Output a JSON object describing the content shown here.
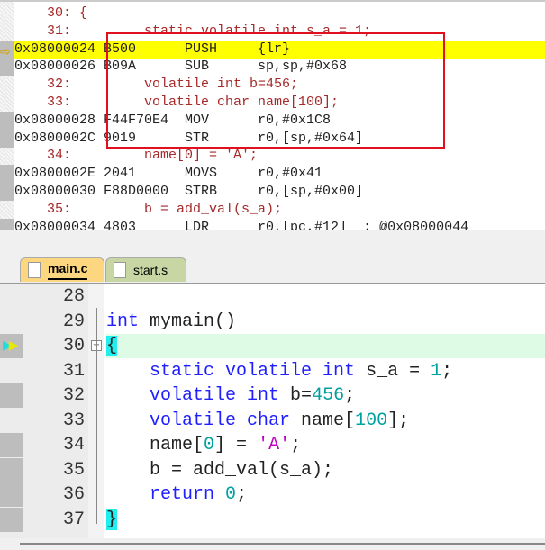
{
  "disassembly": {
    "rows": [
      {
        "kind": "src",
        "exec": false,
        "text": "    30: {"
      },
      {
        "kind": "src",
        "exec": false,
        "text": "    31:         static volatile int s_a = 1;"
      },
      {
        "kind": "asm",
        "exec": true,
        "current": true,
        "text": "0x08000024 B500      PUSH     {lr}"
      },
      {
        "kind": "asm",
        "exec": true,
        "text": "0x08000026 B09A      SUB      sp,sp,#0x68"
      },
      {
        "kind": "src",
        "exec": false,
        "text": "    32:         volatile int b=456;"
      },
      {
        "kind": "src",
        "exec": false,
        "text": "    33:         volatile char name[100];"
      },
      {
        "kind": "asm",
        "exec": true,
        "text": "0x08000028 F44F70E4  MOV      r0,#0x1C8"
      },
      {
        "kind": "asm",
        "exec": true,
        "text": "0x0800002C 9019      STR      r0,[sp,#0x64]"
      },
      {
        "kind": "src",
        "exec": false,
        "text": "    34:         name[0] = 'A';"
      },
      {
        "kind": "asm",
        "exec": true,
        "text": "0x0800002E 2041      MOVS     r0,#0x41"
      },
      {
        "kind": "asm",
        "exec": true,
        "text": "0x08000030 F88D0000  STRB     r0,[sp,#0x00]"
      },
      {
        "kind": "src",
        "exec": false,
        "text": "    35:         b = add_val(s_a);"
      },
      {
        "kind": "asm",
        "exec": true,
        "text": "0x08000034 4803      LDR      r0,[pc,#12]  ; @0x08000044"
      }
    ],
    "current_arrow_icon": "arrow-right-icon",
    "highlight_color": "#ffff00",
    "annotation_box_color": "#e0101e"
  },
  "tabs": [
    {
      "label": "main.c",
      "active": true,
      "icon": "file-icon"
    },
    {
      "label": "start.s",
      "active": false,
      "icon": "file-icon"
    }
  ],
  "editor": {
    "lines": [
      {
        "num": "28",
        "exec": false,
        "tokens": []
      },
      {
        "num": "29",
        "exec": false,
        "tokens": [
          {
            "t": "int",
            "c": "kw"
          },
          {
            "t": " mymain()",
            "c": ""
          }
        ]
      },
      {
        "num": "30",
        "exec": true,
        "current": true,
        "fold": true,
        "tokens": [
          {
            "t": "{",
            "c": "br"
          }
        ]
      },
      {
        "num": "31",
        "exec": false,
        "tokens": [
          {
            "t": "    ",
            "c": ""
          },
          {
            "t": "static volatile int",
            "c": "kw"
          },
          {
            "t": " s_a = ",
            "c": ""
          },
          {
            "t": "1",
            "c": "nm"
          },
          {
            "t": ";",
            "c": ""
          }
        ]
      },
      {
        "num": "32",
        "exec": true,
        "tokens": [
          {
            "t": "    ",
            "c": ""
          },
          {
            "t": "volatile int",
            "c": "kw"
          },
          {
            "t": " b=",
            "c": ""
          },
          {
            "t": "456",
            "c": "nm"
          },
          {
            "t": ";",
            "c": ""
          }
        ]
      },
      {
        "num": "33",
        "exec": false,
        "tokens": [
          {
            "t": "    ",
            "c": ""
          },
          {
            "t": "volatile char",
            "c": "kw"
          },
          {
            "t": " name[",
            "c": ""
          },
          {
            "t": "100",
            "c": "nm"
          },
          {
            "t": "];",
            "c": ""
          }
        ]
      },
      {
        "num": "34",
        "exec": true,
        "tokens": [
          {
            "t": "    name[",
            "c": ""
          },
          {
            "t": "0",
            "c": "nm"
          },
          {
            "t": "] = ",
            "c": ""
          },
          {
            "t": "'A'",
            "c": "ch"
          },
          {
            "t": ";",
            "c": ""
          }
        ]
      },
      {
        "num": "35",
        "exec": true,
        "tokens": [
          {
            "t": "    b = add_val(s_a);",
            "c": ""
          }
        ]
      },
      {
        "num": "36",
        "exec": true,
        "tokens": [
          {
            "t": "    ",
            "c": ""
          },
          {
            "t": "return",
            "c": "kw"
          },
          {
            "t": " ",
            "c": ""
          },
          {
            "t": "0",
            "c": "nm"
          },
          {
            "t": ";",
            "c": ""
          }
        ]
      },
      {
        "num": "37",
        "exec": true,
        "tokens": [
          {
            "t": "}",
            "c": "br"
          }
        ]
      }
    ],
    "current_line_icon": "execution-pointer-icon"
  }
}
